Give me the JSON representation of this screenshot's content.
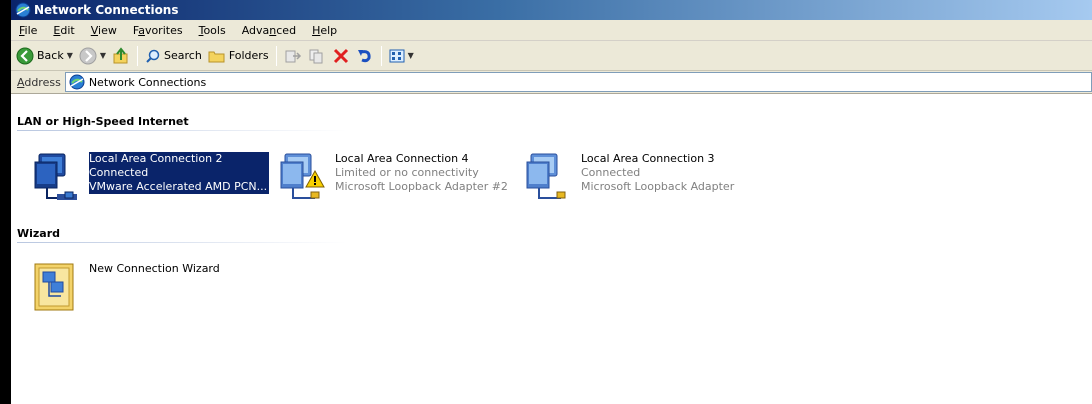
{
  "window": {
    "title": "Network Connections"
  },
  "menu": [
    {
      "label": "File",
      "acc": "F",
      "rest": "ile"
    },
    {
      "label": "Edit",
      "acc": "E",
      "rest": "dit"
    },
    {
      "label": "View",
      "acc": "V",
      "rest": "iew"
    },
    {
      "label": "Favorites",
      "pre": "F",
      "acc": "a",
      "rest": "vorites"
    },
    {
      "label": "Tools",
      "acc": "T",
      "rest": "ools"
    },
    {
      "label": "Advanced",
      "pre": "Adva",
      "acc": "n",
      "rest": "ced"
    },
    {
      "label": "Help",
      "acc": "H",
      "rest": "elp"
    }
  ],
  "toolbar": {
    "back_label": "Back",
    "search_label": "Search",
    "folders_label": "Folders"
  },
  "address": {
    "label_acc": "A",
    "label_rest": "ddress",
    "value": "Network Connections"
  },
  "groups": {
    "lan_title": "LAN or High-Speed Internet",
    "wizard_title": "Wizard"
  },
  "connections": [
    {
      "name": "Local Area Connection 2",
      "status": "Connected",
      "device": "VMware Accelerated AMD PCN...",
      "selected": true,
      "warning": false
    },
    {
      "name": "Local Area Connection 4",
      "status": "Limited or no connectivity",
      "device": "Microsoft Loopback Adapter #2",
      "selected": false,
      "warning": true
    },
    {
      "name": "Local Area Connection 3",
      "status": "Connected",
      "device": "Microsoft Loopback Adapter",
      "selected": false,
      "warning": false
    }
  ],
  "wizard": {
    "name": "New Connection Wizard"
  },
  "colors": {
    "title_gradient_start": "#0a246a",
    "selection": "#0a246a",
    "chrome": "#ece9d8",
    "warning": "#f8d000"
  }
}
